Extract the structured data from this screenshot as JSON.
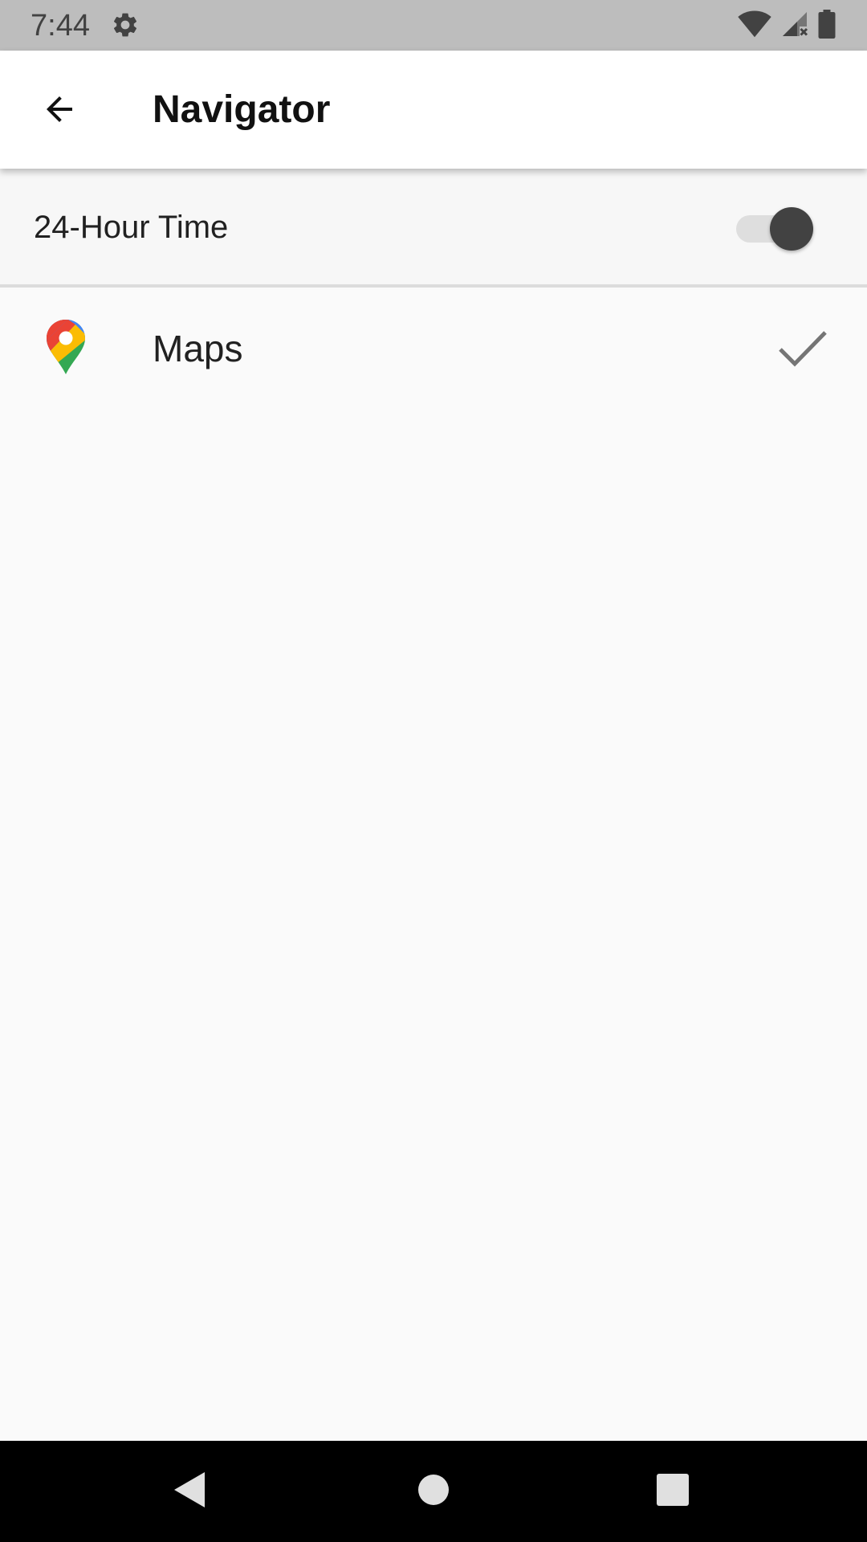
{
  "status_bar": {
    "time": "7:44",
    "icons": [
      "gear-icon",
      "wifi-icon",
      "cellular-no-signal-icon",
      "battery-icon"
    ]
  },
  "app_bar": {
    "title": "Navigator",
    "back_icon": "arrow-back-icon"
  },
  "settings": {
    "toggle_label": "24-Hour Time",
    "toggle_on": true
  },
  "apps": [
    {
      "label": "Maps",
      "icon": "google-maps-icon",
      "selected": true
    }
  ],
  "nav_bar": {
    "icons": [
      "nav-back-icon",
      "nav-home-icon",
      "nav-recents-icon"
    ]
  },
  "colors": {
    "status_bar_bg": "#bdbdbd",
    "app_bar_bg": "#ffffff",
    "page_bg": "#fafafa",
    "switch_thumb": "#424242",
    "switch_track": "#dedede",
    "check_color": "#757575",
    "nav_bar_bg": "#000000"
  }
}
